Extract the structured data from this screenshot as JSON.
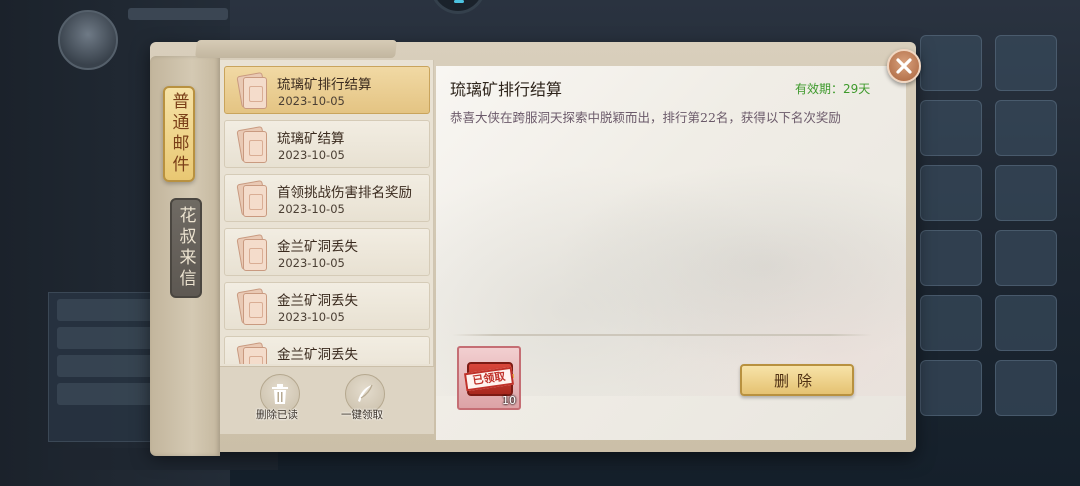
{
  "tabs": [
    {
      "label": "普通邮件",
      "active": true
    },
    {
      "label": "花叔来信",
      "active": false
    }
  ],
  "mail_list": [
    {
      "title": "琉璃矿排行结算",
      "date": "2023-10-05",
      "selected": true
    },
    {
      "title": "琉璃矿结算",
      "date": "2023-10-05",
      "selected": false
    },
    {
      "title": "首领挑战伤害排名奖励",
      "date": "2023-10-05",
      "selected": false
    },
    {
      "title": "金兰矿洞丢失",
      "date": "2023-10-05",
      "selected": false
    },
    {
      "title": "金兰矿洞丢失",
      "date": "2023-10-05",
      "selected": false
    },
    {
      "title": "金兰矿洞丢失",
      "date": "",
      "selected": false
    }
  ],
  "list_actions": {
    "delete_read_label": "删除已读",
    "claim_all_label": "一键领取"
  },
  "mail_detail": {
    "title": "琉璃矿排行结算",
    "validity": "有效期：29天",
    "body": "恭喜大侠在跨服洞天探索中脱颖而出，排行第22名，获得以下名次奖励",
    "reward": {
      "stamp": "已领取",
      "count": "10",
      "icon": "treasure-chest-icon"
    }
  },
  "actions": {
    "delete_label": "删除",
    "close_icon": "close-icon"
  },
  "colors": {
    "validity_green": "#3e9a2c",
    "active_tab": "#e9c873",
    "selected_item": "#e4c483",
    "stamp_red": "#c0322a"
  }
}
